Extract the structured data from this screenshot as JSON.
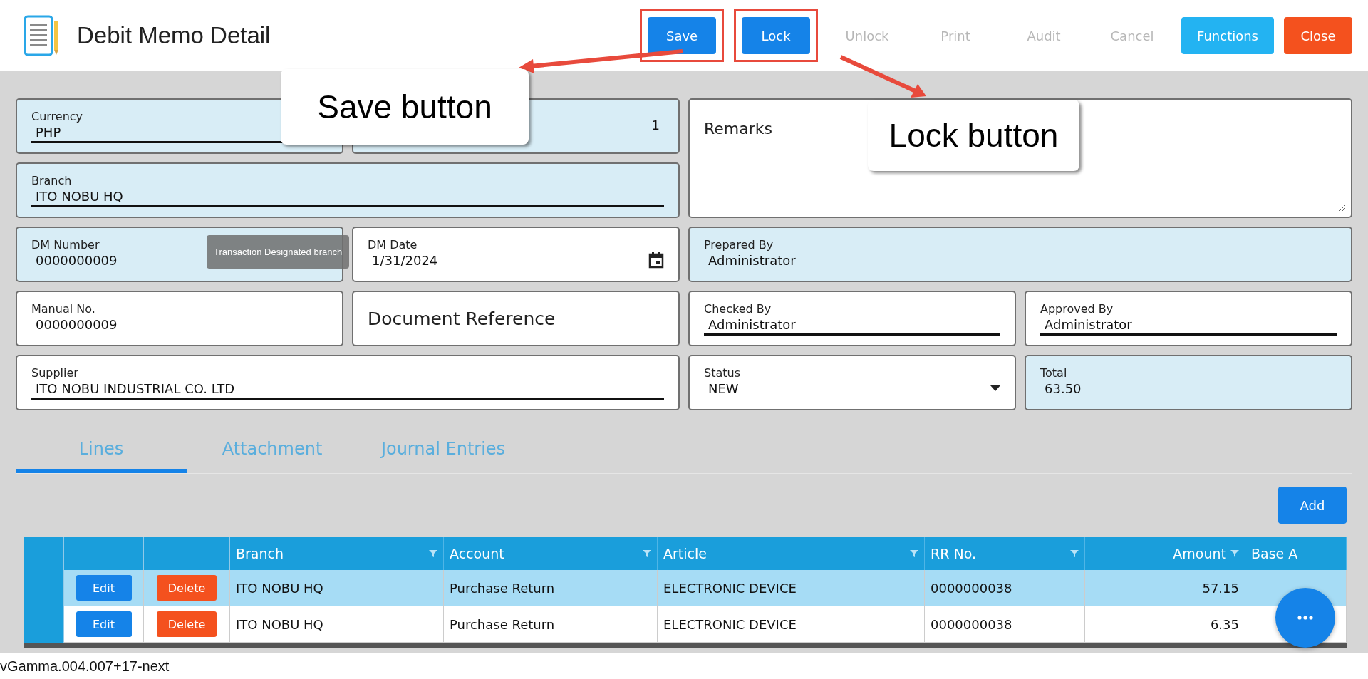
{
  "header": {
    "title": "Debit Memo Detail",
    "actions": [
      {
        "label": "Save",
        "kind": "primary",
        "disabled": false,
        "highlighted": true
      },
      {
        "label": "Lock",
        "kind": "primary",
        "disabled": false,
        "highlighted": true
      },
      {
        "label": "Unlock",
        "kind": "plain",
        "disabled": true,
        "highlighted": false
      },
      {
        "label": "Print",
        "kind": "plain",
        "disabled": true,
        "highlighted": false
      },
      {
        "label": "Audit",
        "kind": "plain",
        "disabled": true,
        "highlighted": false
      },
      {
        "label": "Cancel",
        "kind": "plain",
        "disabled": true,
        "highlighted": false
      },
      {
        "label": "Functions",
        "kind": "info",
        "disabled": false,
        "highlighted": false
      },
      {
        "label": "Close",
        "kind": "danger",
        "disabled": false,
        "highlighted": false
      }
    ]
  },
  "form": {
    "left": [
      [
        {
          "label": "Currency",
          "value": "PHP",
          "kind": "combo",
          "readonly": true
        },
        {
          "value": "1",
          "kind": "number",
          "readonly": true
        }
      ],
      [
        {
          "label": "Branch",
          "value": "ITO NOBU HQ",
          "kind": "combo",
          "readonly": true
        }
      ],
      [
        {
          "label": "DM Number",
          "value": "0000000009",
          "kind": "text",
          "readonly": true
        },
        {
          "label": "DM Date",
          "value": "1/31/2024",
          "kind": "date",
          "readonly": false
        }
      ],
      [
        {
          "label": "Manual No.",
          "value": "0000000009",
          "kind": "text",
          "readonly": false
        },
        {
          "label": "Document Reference",
          "kind": "action",
          "readonly": false
        }
      ],
      [
        {
          "label": "Supplier",
          "value": "ITO NOBU INDUSTRIAL CO. LTD",
          "kind": "combo",
          "readonly": false
        }
      ]
    ],
    "right": [
      [
        {
          "label": "Remarks",
          "kind": "textarea",
          "readonly": false
        }
      ],
      [
        {
          "label": "Prepared By",
          "value": "Administrator",
          "kind": "text",
          "readonly": true
        }
      ],
      [
        {
          "label": "Checked By",
          "value": "Administrator",
          "kind": "combo",
          "readonly": false
        },
        {
          "label": "Approved By",
          "value": "Administrator",
          "kind": "combo",
          "readonly": false
        }
      ],
      [
        {
          "label": "Status",
          "value": "NEW",
          "kind": "select",
          "readonly": false
        },
        {
          "label": "Total",
          "value": "63.50",
          "kind": "text",
          "readonly": true
        }
      ]
    ]
  },
  "tooltip": "Transaction Designated branch",
  "tabs": [
    {
      "label": "Lines",
      "selected": true
    },
    {
      "label": "Attachment",
      "selected": false
    },
    {
      "label": "Journal Entries",
      "selected": false
    }
  ],
  "add_button": "Add",
  "table": {
    "columns": [
      {
        "label": "Branch",
        "filter": true,
        "numeric": false
      },
      {
        "label": "Account",
        "filter": true,
        "numeric": false
      },
      {
        "label": "Article",
        "filter": true,
        "numeric": false
      },
      {
        "label": "RR No.",
        "filter": true,
        "numeric": false
      },
      {
        "label": "Amount",
        "filter": true,
        "numeric": true
      },
      {
        "label": "Base A",
        "filter": false,
        "numeric": false
      }
    ],
    "rows": [
      {
        "selected": true,
        "edit": "Edit",
        "delete": "Delete",
        "cells": [
          "ITO NOBU HQ",
          "Purchase Return",
          "ELECTRONIC DEVICE",
          "0000000038",
          "57.15",
          ""
        ]
      },
      {
        "selected": false,
        "edit": "Edit",
        "delete": "Delete",
        "cells": [
          "ITO NOBU HQ",
          "Purchase Return",
          "ELECTRONIC DEVICE",
          "0000000038",
          "6.35",
          ""
        ]
      }
    ]
  },
  "callouts": [
    "Save button",
    "Lock button"
  ],
  "version": "vGamma.004.007+17-next"
}
